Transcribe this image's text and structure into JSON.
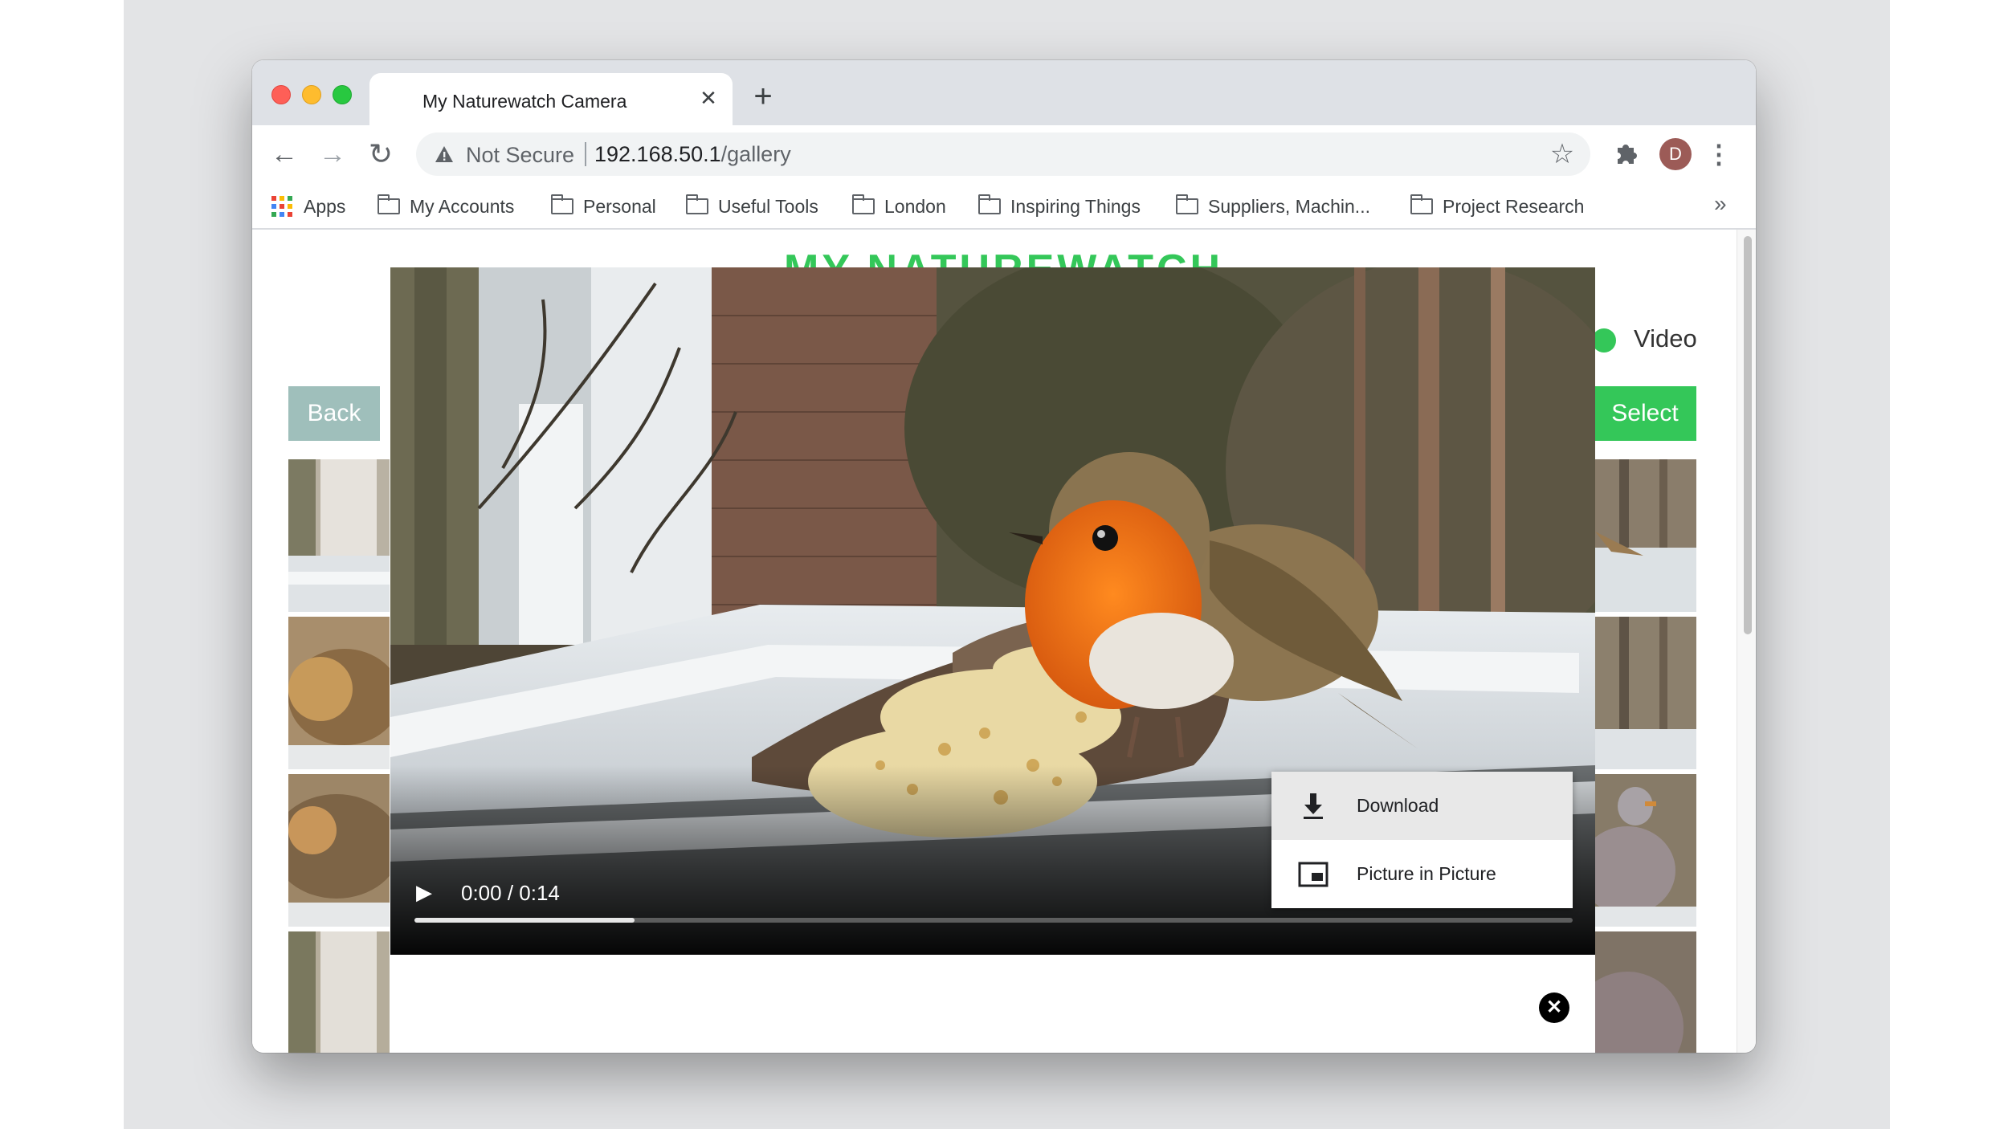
{
  "browser": {
    "tab_title": "My Naturewatch Camera",
    "tab_close": "✕",
    "new_tab": "+",
    "security_label": "Not Secure",
    "url_host": "192.168.50.1",
    "url_path": "/gallery",
    "avatar_letter": "D",
    "bookmarks": [
      {
        "label": "Apps"
      },
      {
        "label": "My Accounts"
      },
      {
        "label": "Personal"
      },
      {
        "label": "Useful Tools"
      },
      {
        "label": "London"
      },
      {
        "label": "Inspiring Things"
      },
      {
        "label": "Suppliers, Machin..."
      },
      {
        "label": "Project Research"
      }
    ],
    "bookmarks_more": "»"
  },
  "page": {
    "title": "MY NATUREWATCH",
    "back_label": "Back",
    "select_label": "Select",
    "video_label": "Video"
  },
  "player": {
    "time": "0:00 / 0:14",
    "progress": 0.19,
    "menu": [
      {
        "label": "Download",
        "icon": "download-icon"
      },
      {
        "label": "Picture in Picture",
        "icon": "picture-in-picture-icon"
      }
    ],
    "close": "✕"
  },
  "colors": {
    "accent_green": "#34c759",
    "back_button": "#9fbfbb"
  }
}
